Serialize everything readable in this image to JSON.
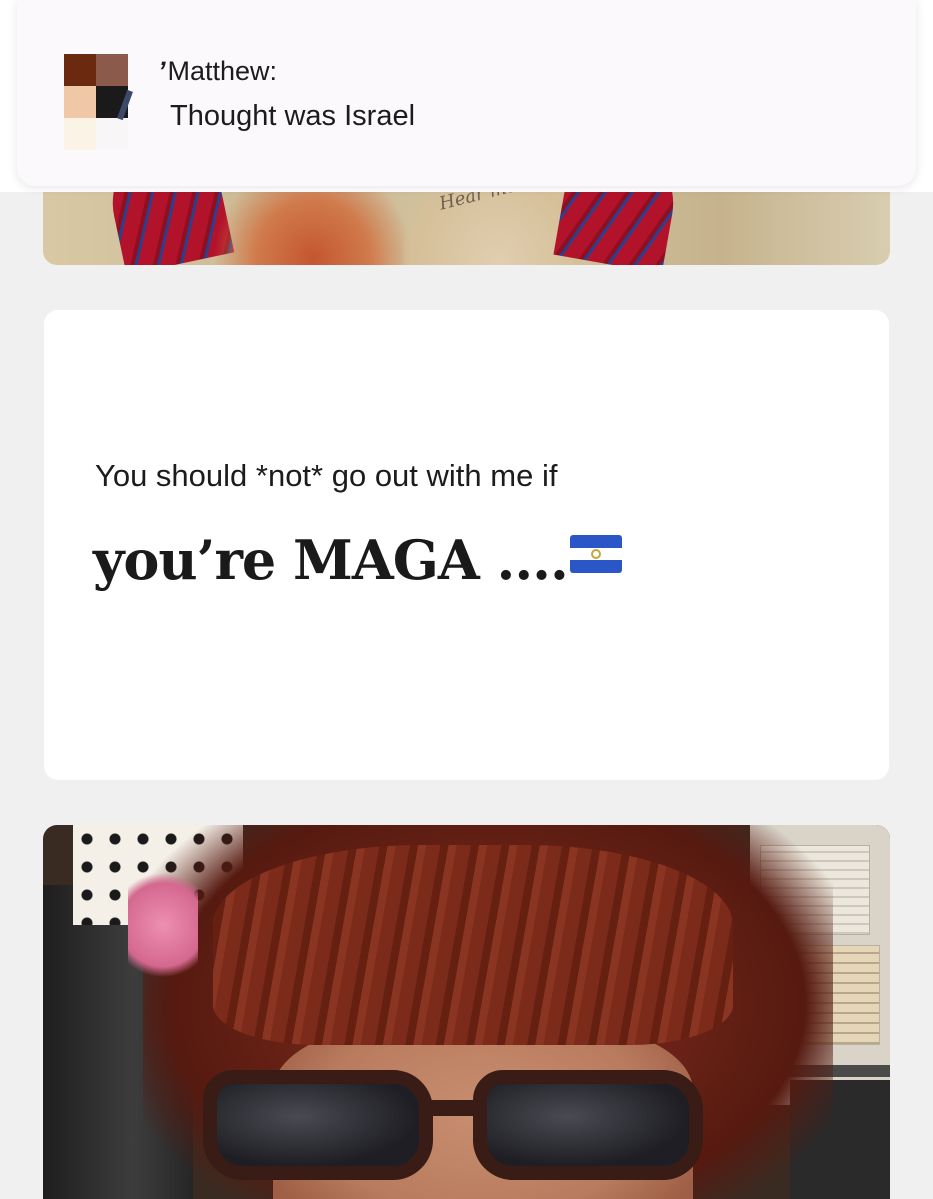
{
  "notification": {
    "sender": "Matthew:",
    "message": "Thought was Israel"
  },
  "top_photo": {
    "tattoo_text": "Hear me out"
  },
  "prompt_card": {
    "question": "You should *not* go out with me if",
    "answer": "you’re MAGA ....",
    "answer_flag_icon": "el-salvador-flag-icon"
  },
  "colors": {
    "page_background": "#f0f0f0",
    "card_background": "#ffffff",
    "banner_background": "#fbf9fb",
    "text_primary": "#1c1c1c"
  }
}
